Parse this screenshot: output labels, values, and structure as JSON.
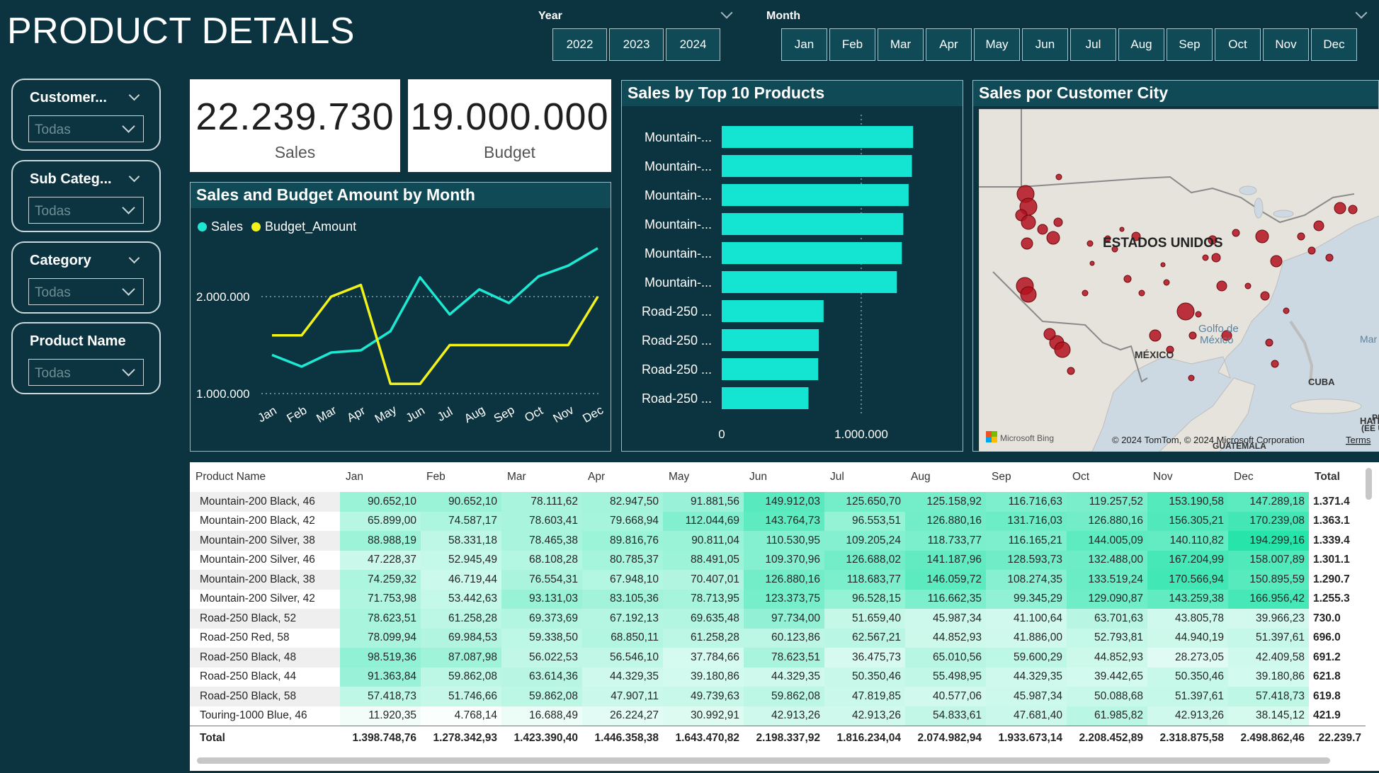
{
  "title": "PRODUCT DETAILS",
  "year_slicer": {
    "label": "Year",
    "options": [
      "2022",
      "2023",
      "2024"
    ]
  },
  "month_slicer": {
    "label": "Month",
    "options": [
      "Jan",
      "Feb",
      "Mar",
      "Apr",
      "May",
      "Jun",
      "Jul",
      "Aug",
      "Sep",
      "Oct",
      "Nov",
      "Dec"
    ]
  },
  "filters": [
    {
      "label": "Customer...",
      "value": "Todas"
    },
    {
      "label": "Sub Categ...",
      "value": "Todas"
    },
    {
      "label": "Category",
      "value": "Todas"
    },
    {
      "label": "Product Name",
      "value": "Todas"
    }
  ],
  "kpis": {
    "sales": {
      "value": "22.239.730",
      "label": "Sales"
    },
    "budget": {
      "value": "19.000.000",
      "label": "Budget"
    }
  },
  "line_chart": {
    "title": "Sales and Budget Amount by Month",
    "legend": [
      "Sales",
      "Budget_Amount"
    ],
    "colors": {
      "sales": "#1de9d2",
      "budget": "#f2f21a"
    },
    "ytick_labels": [
      "2.000.000",
      "1.000.000"
    ],
    "chart_data": {
      "type": "line",
      "categories": [
        "Jan",
        "Feb",
        "Mar",
        "Apr",
        "May",
        "Jun",
        "Jul",
        "Aug",
        "Sep",
        "Oct",
        "Nov",
        "Dec"
      ],
      "series": [
        {
          "name": "Sales",
          "values": [
            1398749,
            1278343,
            1423390,
            1446358,
            1643471,
            2198338,
            1816234,
            2074983,
            1933673,
            2208453,
            2318876,
            2498862
          ]
        },
        {
          "name": "Budget_Amount",
          "values": [
            1600000,
            1600000,
            2000000,
            2120000,
            1100000,
            1100000,
            1500000,
            1500000,
            1500000,
            1500000,
            1500000,
            2000000
          ]
        }
      ],
      "yticks": [
        1000000,
        2000000
      ],
      "ylim": [
        1000000,
        2500000
      ]
    }
  },
  "bar_chart": {
    "title": "Sales by Top 10 Products",
    "color": "#14e5d2",
    "xtick_labels": [
      "0",
      "1.000.000"
    ],
    "chart_data": {
      "type": "bar",
      "categories": [
        "Mountain-...",
        "Mountain-...",
        "Mountain-...",
        "Mountain-...",
        "Mountain-...",
        "Mountain-...",
        "Road-250 ...",
        "Road-250 ...",
        "Road-250 ...",
        "Road-250 ..."
      ],
      "values": [
        1371400,
        1363100,
        1339400,
        1301100,
        1290700,
        1255300,
        730000,
        696000,
        691200,
        621800
      ],
      "xticks": [
        0,
        1000000
      ],
      "xlim": [
        0,
        1400000
      ]
    }
  },
  "map": {
    "title": "Sales por Customer City",
    "country_label": "ESTADOS UNIDOS",
    "labels": [
      "Golfo de",
      "México",
      "MÉXICO",
      "CUBA",
      "HAITÍ",
      "Mar",
      "GUATEMALA",
      "PR",
      "(EE UU"
    ],
    "attribution": "© 2024 TomTom, © 2024 Microsoft Corporation",
    "terms": "Terms",
    "provider": "Microsoft Bing"
  },
  "table": {
    "columns": [
      "Product Name",
      "Jan",
      "Feb",
      "Mar",
      "Apr",
      "May",
      "Jun",
      "Jul",
      "Aug",
      "Sep",
      "Oct",
      "Nov",
      "Dec",
      "Total"
    ],
    "rows": [
      [
        "Mountain-200 Black, 46",
        "90.652,10",
        "90.652,10",
        "78.111,62",
        "82.947,50",
        "91.881,56",
        "149.912,03",
        "125.650,70",
        "125.158,92",
        "116.716,63",
        "119.257,52",
        "153.190,58",
        "147.289,18",
        "1.371.4"
      ],
      [
        "Mountain-200 Black, 42",
        "65.899,00",
        "74.587,17",
        "78.603,41",
        "79.668,94",
        "112.044,69",
        "143.764,73",
        "96.553,51",
        "126.880,16",
        "131.716,03",
        "126.880,16",
        "156.305,21",
        "170.239,08",
        "1.363.1"
      ],
      [
        "Mountain-200 Silver, 38",
        "88.988,19",
        "58.331,18",
        "78.465,38",
        "89.816,76",
        "90.811,04",
        "110.530,95",
        "109.205,24",
        "118.733,77",
        "116.165,21",
        "144.005,09",
        "140.110,82",
        "194.299,16",
        "1.339.4"
      ],
      [
        "Mountain-200 Silver, 46",
        "47.228,37",
        "52.945,49",
        "68.108,28",
        "80.785,37",
        "88.491,05",
        "109.370,96",
        "126.688,02",
        "141.187,96",
        "128.593,73",
        "132.488,00",
        "167.204,99",
        "158.007,89",
        "1.301.1"
      ],
      [
        "Mountain-200 Black, 38",
        "74.259,32",
        "46.719,44",
        "76.554,31",
        "67.948,10",
        "70.407,01",
        "126.880,16",
        "118.683,77",
        "146.059,72",
        "108.274,35",
        "133.519,24",
        "170.566,94",
        "150.895,59",
        "1.290.7"
      ],
      [
        "Mountain-200 Silver, 42",
        "71.753,98",
        "53.442,63",
        "93.131,03",
        "83.105,36",
        "78.713,95",
        "123.373,75",
        "96.528,15",
        "116.662,35",
        "99.345,29",
        "129.090,87",
        "143.259,38",
        "166.956,42",
        "1.255.3"
      ],
      [
        "Road-250 Black, 52",
        "78.623,51",
        "61.258,28",
        "69.373,69",
        "67.192,13",
        "69.635,48",
        "97.734,00",
        "51.659,40",
        "45.987,34",
        "41.100,64",
        "63.701,63",
        "43.805,78",
        "39.966,23",
        "730.0"
      ],
      [
        "Road-250 Red, 58",
        "78.099,94",
        "69.984,53",
        "59.338,50",
        "68.850,11",
        "61.258,28",
        "60.123,86",
        "62.567,21",
        "44.852,93",
        "41.886,00",
        "52.793,81",
        "44.940,19",
        "51.397,61",
        "696.0"
      ],
      [
        "Road-250 Black, 48",
        "98.519,36",
        "87.087,98",
        "56.022,53",
        "56.546,10",
        "37.784,66",
        "78.623,51",
        "36.475,73",
        "65.010,56",
        "59.600,29",
        "44.852,93",
        "28.273,05",
        "42.409,58",
        "691.2"
      ],
      [
        "Road-250 Black, 44",
        "91.363,84",
        "59.862,08",
        "63.614,36",
        "44.329,35",
        "39.180,86",
        "44.329,35",
        "50.350,46",
        "55.498,95",
        "44.329,35",
        "39.442,65",
        "50.350,46",
        "39.180,86",
        "621.8"
      ],
      [
        "Road-250 Black, 58",
        "57.418,73",
        "51.746,66",
        "59.862,08",
        "47.907,11",
        "49.739,63",
        "59.862,08",
        "47.819,85",
        "40.577,06",
        "45.987,34",
        "50.088,68",
        "51.397,61",
        "57.418,73",
        "619.8"
      ],
      [
        "Touring-1000 Blue, 46",
        "11.920,35",
        "4.768,14",
        "16.688,49",
        "26.224,27",
        "30.992,91",
        "42.913,26",
        "42.913,26",
        "54.833,61",
        "47.681,40",
        "61.985,82",
        "42.913,26",
        "38.145,12",
        "421.9"
      ]
    ],
    "total_row": [
      "Total",
      "1.398.748,76",
      "1.278.342,93",
      "1.423.390,40",
      "1.446.358,38",
      "1.643.470,82",
      "2.198.337,92",
      "1.816.234,04",
      "2.074.982,94",
      "1.933.673,14",
      "2.208.452,89",
      "2.318.875,58",
      "2.498.862,46",
      "22.239.7"
    ]
  }
}
